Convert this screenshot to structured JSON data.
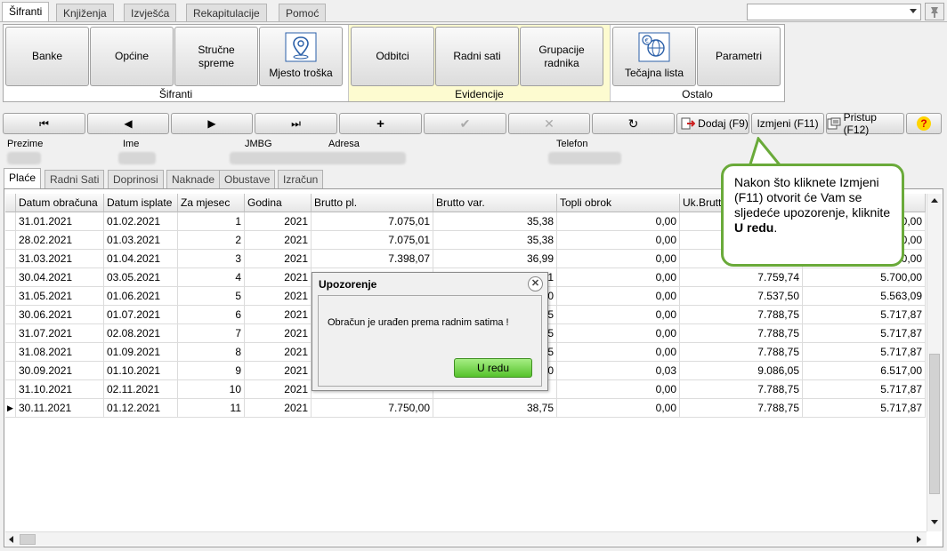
{
  "menu_tabs": [
    "Šifranti",
    "Knjiženja",
    "Izvješća",
    "Rekapitulacije",
    "Pomoć"
  ],
  "search": {
    "value": ""
  },
  "ribbon": {
    "sifranti": {
      "caption": "Šifranti",
      "buttons": [
        "Banke",
        "Općine",
        "Stručne spreme",
        "Mjesto troška"
      ]
    },
    "evidencije": {
      "caption": "Evidencije",
      "buttons": [
        "Odbitci",
        "Radni sati",
        "Grupacije radnika"
      ]
    },
    "ostalo": {
      "caption": "Ostalo",
      "buttons": [
        "Tečajna lista",
        "Parametri"
      ]
    }
  },
  "toolbar": {
    "add": "Dodaj (F9)",
    "edit": "Izmjeni (F11)",
    "access": "Pristup (F12)",
    "help": "?"
  },
  "info_labels": {
    "prezime": "Prezime",
    "ime": "Ime",
    "jmbg": "JMBG",
    "adresa": "Adresa",
    "telefon": "Telefon"
  },
  "sub_tabs": [
    "Plaće",
    "Radni Sati",
    "Doprinosi",
    "Naknade",
    "Obustave",
    "Izračun"
  ],
  "columns": [
    "Datum obračuna",
    "Datum isplate",
    "Za mjesec",
    "Godina",
    "Brutto pl.",
    "Brutto var.",
    "Topli obrok",
    "Uk.Brutto",
    ""
  ],
  "rows": [
    [
      "31.01.2021",
      "01.02.2021",
      "1",
      "2021",
      "7.075,01",
      "35,38",
      "0,00",
      "",
      "0,00"
    ],
    [
      "28.02.2021",
      "01.03.2021",
      "2",
      "2021",
      "7.075,01",
      "35,38",
      "0,00",
      "",
      "0,00"
    ],
    [
      "31.03.2021",
      "01.04.2021",
      "3",
      "2021",
      "7.398,07",
      "36,99",
      "0,00",
      "",
      "0,00"
    ],
    [
      "30.04.2021",
      "03.05.2021",
      "4",
      "2021",
      "",
      "1",
      "0,00",
      "7.759,74",
      "5.700,00"
    ],
    [
      "31.05.2021",
      "01.06.2021",
      "5",
      "2021",
      "",
      "0",
      "0,00",
      "7.537,50",
      "5.563,09"
    ],
    [
      "30.06.2021",
      "01.07.2021",
      "6",
      "2021",
      "",
      "5",
      "0,00",
      "7.788,75",
      "5.717,87"
    ],
    [
      "31.07.2021",
      "02.08.2021",
      "7",
      "2021",
      "",
      "5",
      "0,00",
      "7.788,75",
      "5.717,87"
    ],
    [
      "31.08.2021",
      "01.09.2021",
      "8",
      "2021",
      "",
      "5",
      "0,00",
      "7.788,75",
      "5.717,87"
    ],
    [
      "30.09.2021",
      "01.10.2021",
      "9",
      "2021",
      "",
      "0",
      "0,03",
      "9.086,05",
      "6.517,00"
    ],
    [
      "31.10.2021",
      "02.11.2021",
      "10",
      "2021",
      "",
      "",
      "0,00",
      "7.788,75",
      "5.717,87"
    ],
    [
      "30.11.2021",
      "01.12.2021",
      "11",
      "2021",
      "7.750,00",
      "38,75",
      "0,00",
      "7.788,75",
      "5.717,87"
    ]
  ],
  "dialog": {
    "title": "Upozorenje",
    "message": "Obračun je urađen prema radnim satima !",
    "ok": "U redu"
  },
  "callout": {
    "text": "Nakon što kliknete Izmjeni (F11) otvorit će Vam se sljedeće upozorenje, kliknite ",
    "bold": "U redu",
    "end": "."
  },
  "colors": {
    "evidencije_bg": "#fdfbd0",
    "callout_border": "#6aaa3a",
    "ok_green": "#7ed957"
  }
}
